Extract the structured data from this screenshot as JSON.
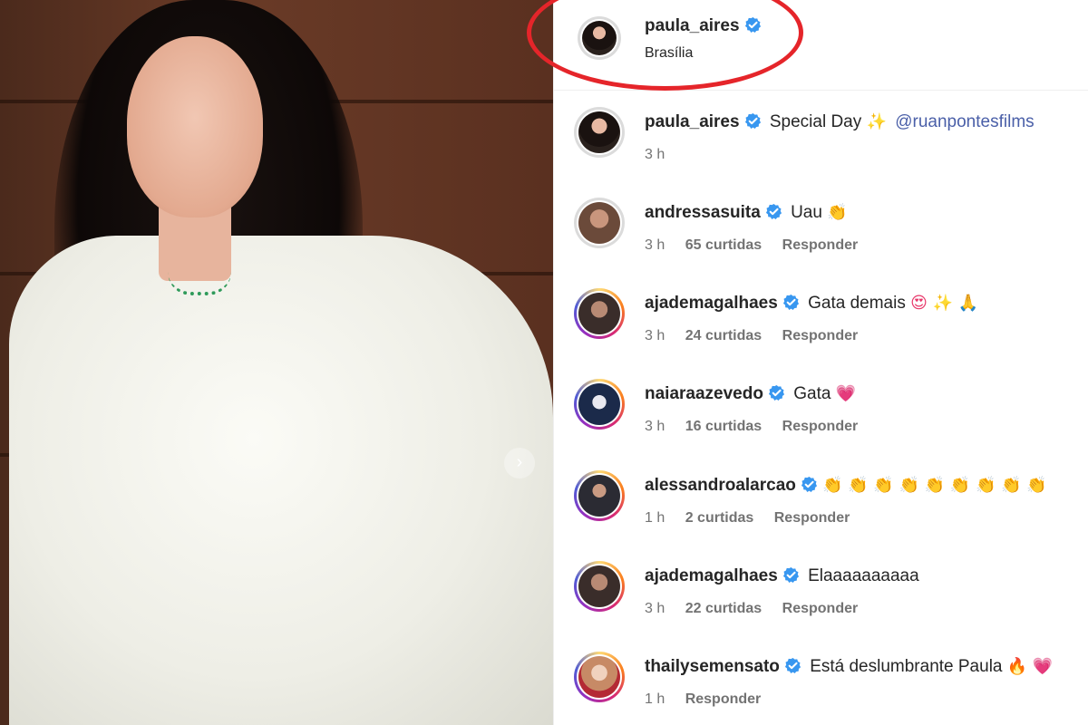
{
  "post": {
    "username": "paula_aires",
    "location": "Brasília",
    "carousel_next_glyph": "›"
  },
  "caption": {
    "username": "paula_aires",
    "text": "Special Day",
    "emoji": "✨",
    "mention": "@ruanpontesfilms",
    "time": "3 h"
  },
  "comments": [
    {
      "username": "andressasuita",
      "text": "Uau",
      "emoji": "👏",
      "time": "3 h",
      "likes": "65 curtidas",
      "reply": "Responder",
      "avatar_color": "#6b4a3a"
    },
    {
      "username": "ajademagalhaes",
      "text": "Gata demais",
      "emoji": "😍 ✨ 🙏",
      "time": "3 h",
      "likes": "24 curtidas",
      "reply": "Responder",
      "avatar_color": "#3a2d2a"
    },
    {
      "username": "naiaraazevedo",
      "text": "Gata",
      "emoji": "💗",
      "time": "3 h",
      "likes": "16 curtidas",
      "reply": "Responder",
      "avatar_color": "#1b2a4a"
    },
    {
      "username": "alessandroalarcao",
      "text": "",
      "emoji": "👏 👏 👏 👏 👏 👏 👏 👏 👏",
      "time": "1 h",
      "likes": "2 curtidas",
      "reply": "Responder",
      "avatar_color": "#2b2b33"
    },
    {
      "username": "ajademagalhaes",
      "text": "Elaaaaaaaaaa",
      "emoji": "",
      "time": "3 h",
      "likes": "22 curtidas",
      "reply": "Responder",
      "avatar_color": "#3a2d2a"
    },
    {
      "username": "thailysemensato",
      "text": "Está deslumbrante Paula",
      "emoji": "🔥 💗",
      "time": "1 h",
      "likes": "",
      "reply": "Responder",
      "avatar_color": "#c78a66"
    }
  ],
  "colors": {
    "highlight_ring": "#e5252a",
    "verified_badge": "#3897f0",
    "mention": "#4a5fa8",
    "meta_text": "#737373"
  },
  "icons": {
    "verified": "verified-badge-icon",
    "carousel_next": "chevron-right-icon"
  }
}
